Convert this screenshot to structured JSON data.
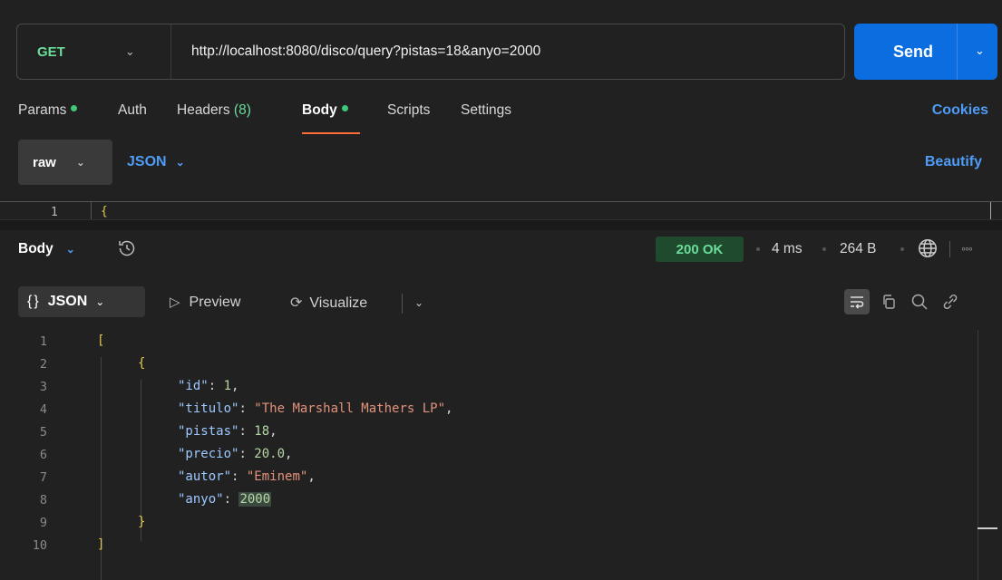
{
  "request": {
    "method": "GET",
    "url": "http://localhost:8080/disco/query?pistas=18&anyo=2000",
    "send_label": "Send"
  },
  "request_tabs": {
    "params": "Params",
    "auth": "Auth",
    "headers": "Headers",
    "headers_count": "(8)",
    "body": "Body",
    "scripts": "Scripts",
    "settings": "Settings",
    "cookies": "Cookies"
  },
  "body_options": {
    "mode": "raw",
    "language": "JSON",
    "beautify": "Beautify"
  },
  "request_editor": {
    "line_number": "1",
    "first_char": "{"
  },
  "response": {
    "view": "Body",
    "status": "200 OK",
    "time": "4 ms",
    "size": "264 B",
    "format": "JSON",
    "preview": "Preview",
    "visualize": "Visualize"
  },
  "response_lines": [
    {
      "n": "1"
    },
    {
      "n": "2"
    },
    {
      "n": "3"
    },
    {
      "n": "4"
    },
    {
      "n": "5"
    },
    {
      "n": "6"
    },
    {
      "n": "7"
    },
    {
      "n": "8"
    },
    {
      "n": "9"
    },
    {
      "n": "10"
    }
  ],
  "response_json": {
    "open_bracket": "[",
    "open_brace": "{",
    "fields": [
      {
        "key": "\"id\"",
        "value": "1",
        "type": "number"
      },
      {
        "key": "\"titulo\"",
        "value": "\"The Marshall Mathers LP\"",
        "type": "string"
      },
      {
        "key": "\"pistas\"",
        "value": "18",
        "type": "number"
      },
      {
        "key": "\"precio\"",
        "value": "20.0",
        "type": "number"
      },
      {
        "key": "\"autor\"",
        "value": "\"Eminem\"",
        "type": "string"
      },
      {
        "key": "\"anyo\"",
        "value": "2000",
        "type": "number"
      }
    ],
    "close_brace": "}",
    "close_bracket": "]"
  },
  "colors": {
    "accent": "#ff6c37",
    "send": "#0b6de0",
    "link": "#4e9cf5",
    "success": "#6bdd9a"
  },
  "icons": [
    "chevron-down-icon",
    "history-icon",
    "globe-icon",
    "more-icon",
    "play-icon",
    "visualize-icon",
    "wrap-lines-icon",
    "copy-icon",
    "search-icon",
    "link-icon"
  ]
}
